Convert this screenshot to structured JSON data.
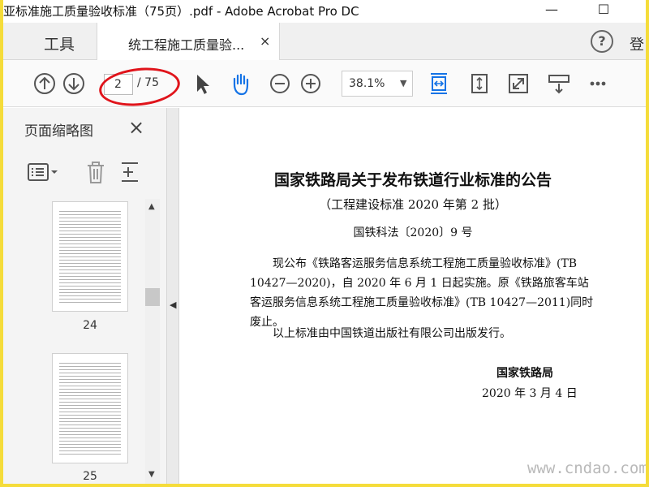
{
  "window": {
    "title": "亚标准施工质量验收标准（75页）.pdf - Adobe Acrobat Pro DC",
    "minimize": "—",
    "maximize": "☐"
  },
  "tabs": {
    "tools": "工具",
    "document": "统工程施工质量验...",
    "close": "×",
    "help": "?",
    "login": "登"
  },
  "toolbar": {
    "page_current": "2",
    "page_total": "/ 75",
    "zoom": "38.1%",
    "zoom_caret": "▼",
    "icons": [
      "page-up-icon",
      "page-down-icon",
      "select-cursor-icon",
      "hand-tool-icon",
      "zoom-out-icon",
      "zoom-in-icon",
      "fit-page-icon",
      "scroll-mode-icon",
      "fullscreen-icon",
      "read-mode-icon",
      "more-icon"
    ],
    "accent": "#1473e6",
    "highlight": "#e0141b"
  },
  "side_panel": {
    "header": "页面缩略图",
    "close": "×",
    "scroll_up": "▲",
    "scroll_down": "▼",
    "collapse": "◀",
    "thumbnails": [
      {
        "label": "24"
      },
      {
        "label": "25"
      }
    ]
  },
  "document": {
    "title": "国家铁路局关于发布铁道行业标准的公告",
    "subtitle": "（工程建设标准 2020 年第 2 批）",
    "number": "国铁科法〔2020〕9 号",
    "body": "现公布《铁路客运服务信息系统工程施工质量验收标准》(TB 10427—2020)，自 2020 年 6 月 1 日起实施。原《铁路旅客车站客运服务信息系统工程施工质量验收标准》(TB 10427—2011)同时废止。",
    "para2": "以上标准由中国铁道出版社有限公司出版发行。",
    "issuer": "国家铁路局",
    "date": "2020 年 3 月 4 日",
    "watermark": "www.cndao.com"
  }
}
